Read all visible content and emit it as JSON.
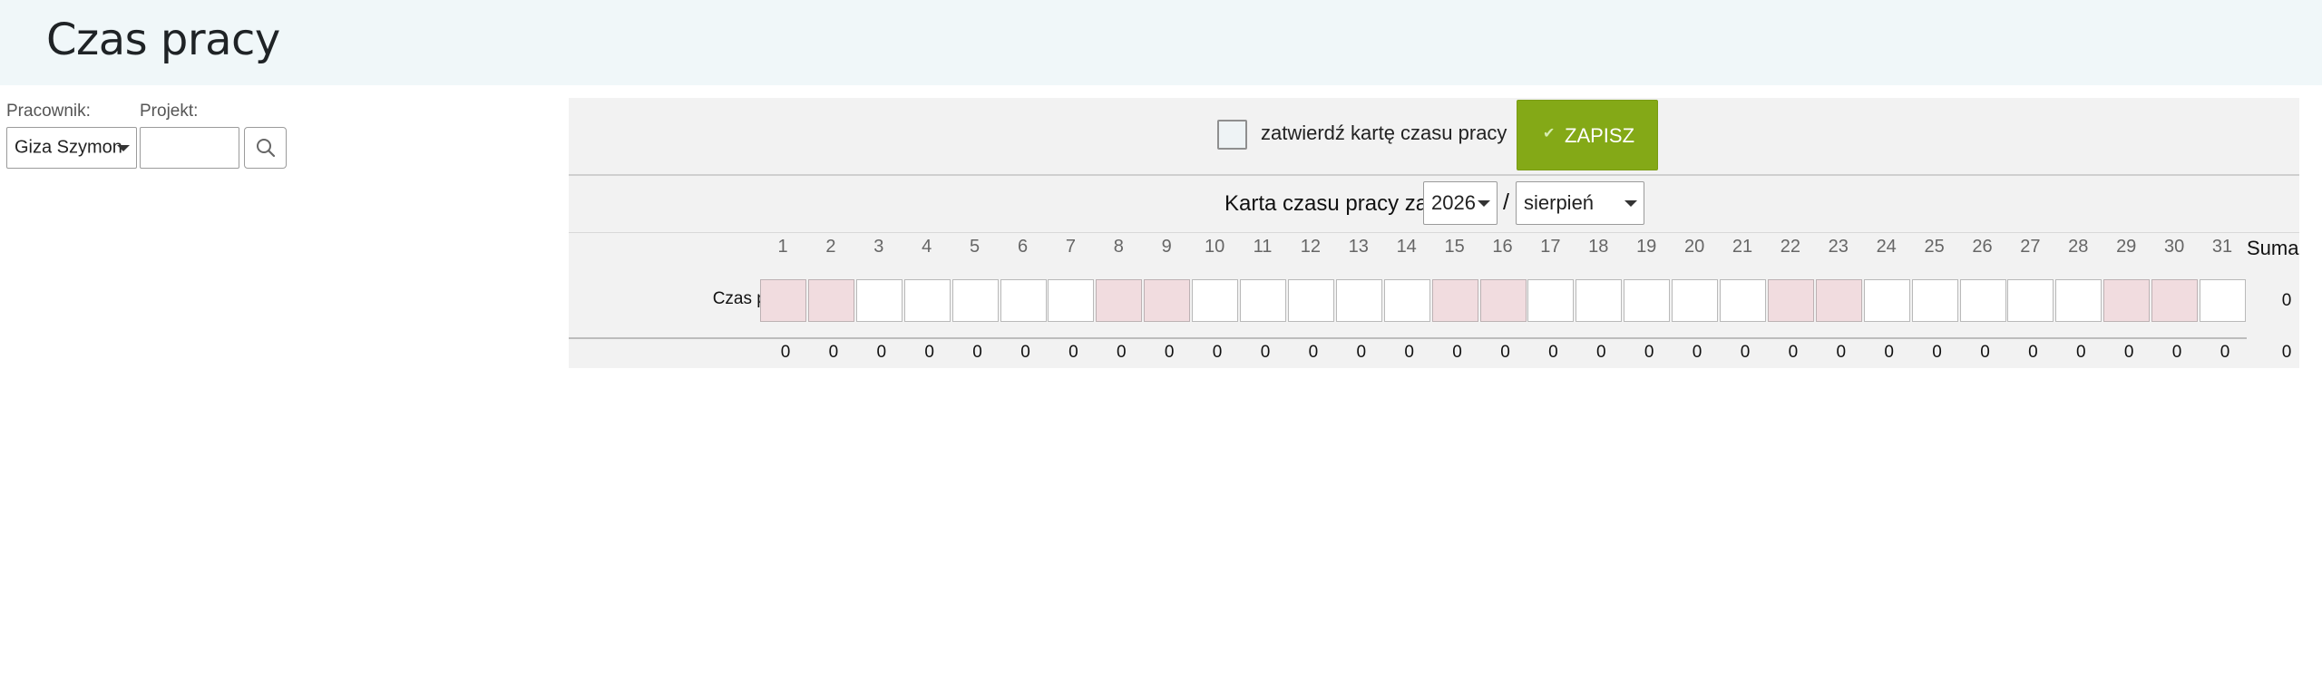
{
  "header": {
    "title": "Czas pracy"
  },
  "filters": {
    "employee_label": "Pracownik:",
    "employee_value": "Giza Szymon",
    "project_label": "Projekt:",
    "project_value": "",
    "search_icon": "search-icon"
  },
  "toolbar": {
    "approve_label": "zatwierdź kartę czasu pracy",
    "approve_checked": false,
    "save_label": "ZAPISZ",
    "save_icon": "check-icon"
  },
  "period": {
    "label": "Karta czasu pracy za:",
    "year": "2026",
    "separator": "/",
    "month": "sierpień"
  },
  "grid": {
    "days": [
      "1",
      "2",
      "3",
      "4",
      "5",
      "6",
      "7",
      "8",
      "9",
      "10",
      "11",
      "12",
      "13",
      "14",
      "15",
      "16",
      "17",
      "18",
      "19",
      "20",
      "21",
      "22",
      "23",
      "24",
      "25",
      "26",
      "27",
      "28",
      "29",
      "30",
      "31"
    ],
    "weekend_days": [
      1,
      2,
      8,
      9,
      15,
      16,
      22,
      23,
      29,
      30
    ],
    "sum_header": "Suma",
    "row_label": "Czas pracy:",
    "row_total": "0",
    "day_totals": [
      "0",
      "0",
      "0",
      "0",
      "0",
      "0",
      "0",
      "0",
      "0",
      "0",
      "0",
      "0",
      "0",
      "0",
      "0",
      "0",
      "0",
      "0",
      "0",
      "0",
      "0",
      "0",
      "0",
      "0",
      "0",
      "0",
      "0",
      "0",
      "0",
      "0",
      "0"
    ],
    "grand_total": "0"
  },
  "colors": {
    "header_bg": "#f0f7f9",
    "panel_bg": "#f2f2f2",
    "save_button": "#84a917",
    "weekend_cell": "#f1dcdf"
  }
}
